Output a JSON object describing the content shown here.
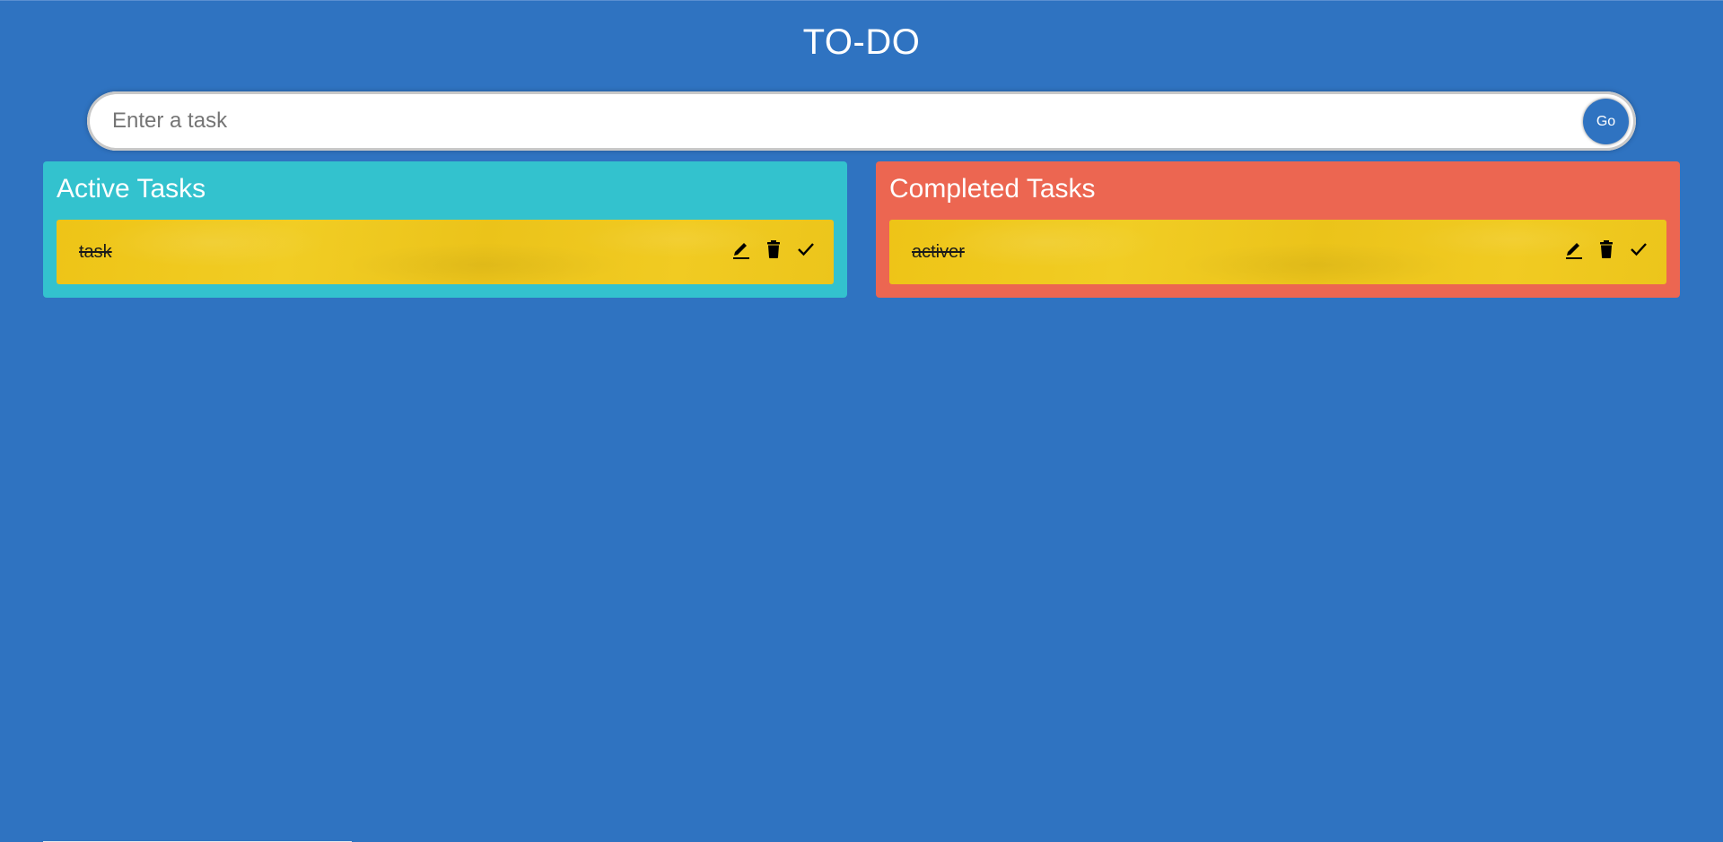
{
  "app": {
    "title": "TO-DO"
  },
  "form": {
    "placeholder": "Enter a task",
    "go_label": "Go"
  },
  "panels": {
    "active": {
      "title": "Active Tasks",
      "color": "#33c2ce",
      "tasks": [
        {
          "text": "task"
        }
      ]
    },
    "completed": {
      "title": "Completed Tasks",
      "color": "#ec6651",
      "tasks": [
        {
          "text": "activer"
        }
      ]
    }
  },
  "icons": [
    "edit-icon",
    "delete-icon",
    "check-icon"
  ],
  "colors": {
    "background": "#2f73c1",
    "card": "#f0c91f"
  }
}
